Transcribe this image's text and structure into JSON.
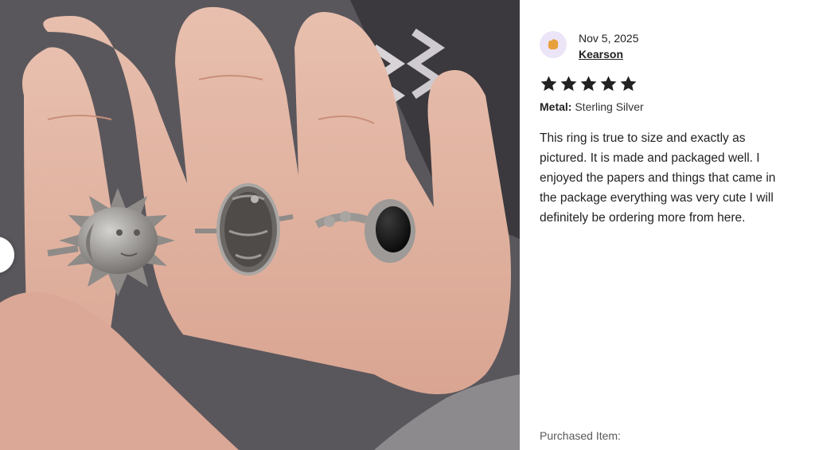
{
  "photo": {
    "alt_icon": "review-photo",
    "prev_icon": "chevron-left-icon",
    "next_icon": "chevron-right-icon"
  },
  "review": {
    "date": "Nov 5, 2025",
    "reviewer_name": "Kearson",
    "avatar_icon": "user-avatar-icon",
    "rating": 5,
    "rating_max": 5,
    "star_color": "#222222",
    "variation_label": "Metal:",
    "variation_value": "Sterling Silver",
    "text": "This ring is true to size and exactly as pictured. It is made and packaged well. I enjoyed the papers and things that came in the package everything was very cute I will definitely be ordering more from here.",
    "purchased_label": "Purchased Item:"
  },
  "colors": {
    "avatar_bg": "#ece4f7",
    "avatar_fg": "#e8a13a",
    "panel_bg": "#ffffff"
  }
}
